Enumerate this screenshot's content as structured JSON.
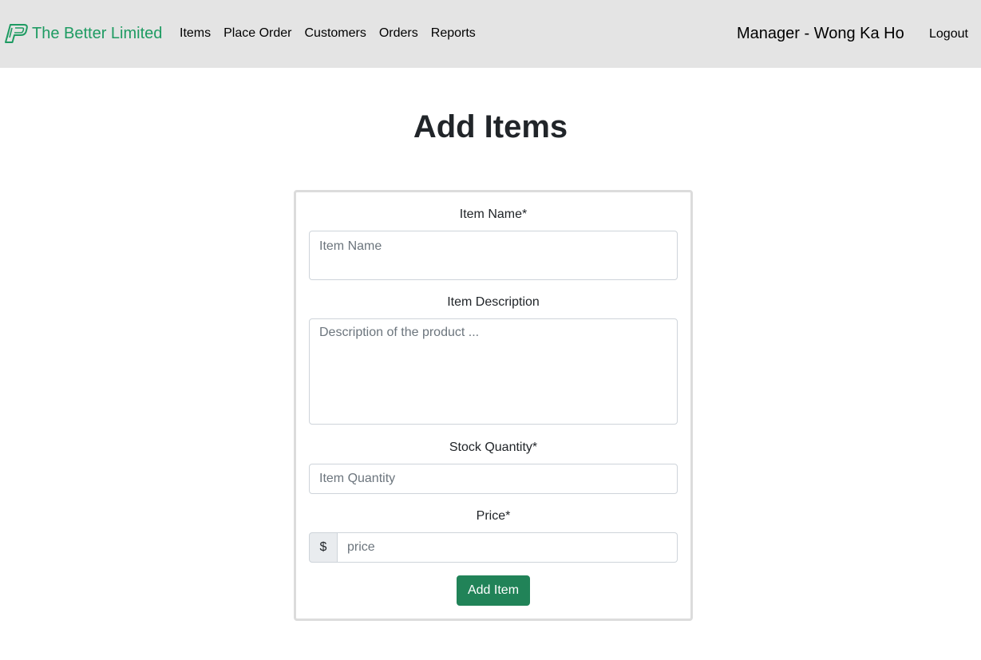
{
  "navbar": {
    "brand": "The Better Limited",
    "brand_icon": "company-logo-icon",
    "links": [
      "Items",
      "Place Order",
      "Customers",
      "Orders",
      "Reports"
    ],
    "user": "Manager - Wong Ka Ho",
    "logout": "Logout"
  },
  "page": {
    "title": "Add Items"
  },
  "form": {
    "item_name_label": "Item Name*",
    "item_name_placeholder": "Item Name",
    "description_label": "Item Description",
    "description_placeholder": "Description of the product ...",
    "quantity_label": "Stock Quantity*",
    "quantity_placeholder": "Item Quantity",
    "price_label": "Price*",
    "currency_symbol": "$",
    "price_placeholder": "price",
    "submit_label": "Add Item"
  },
  "colors": {
    "brand": "#1e9b62",
    "navbar_bg": "#e4e4e4",
    "primary_button": "#218358"
  }
}
